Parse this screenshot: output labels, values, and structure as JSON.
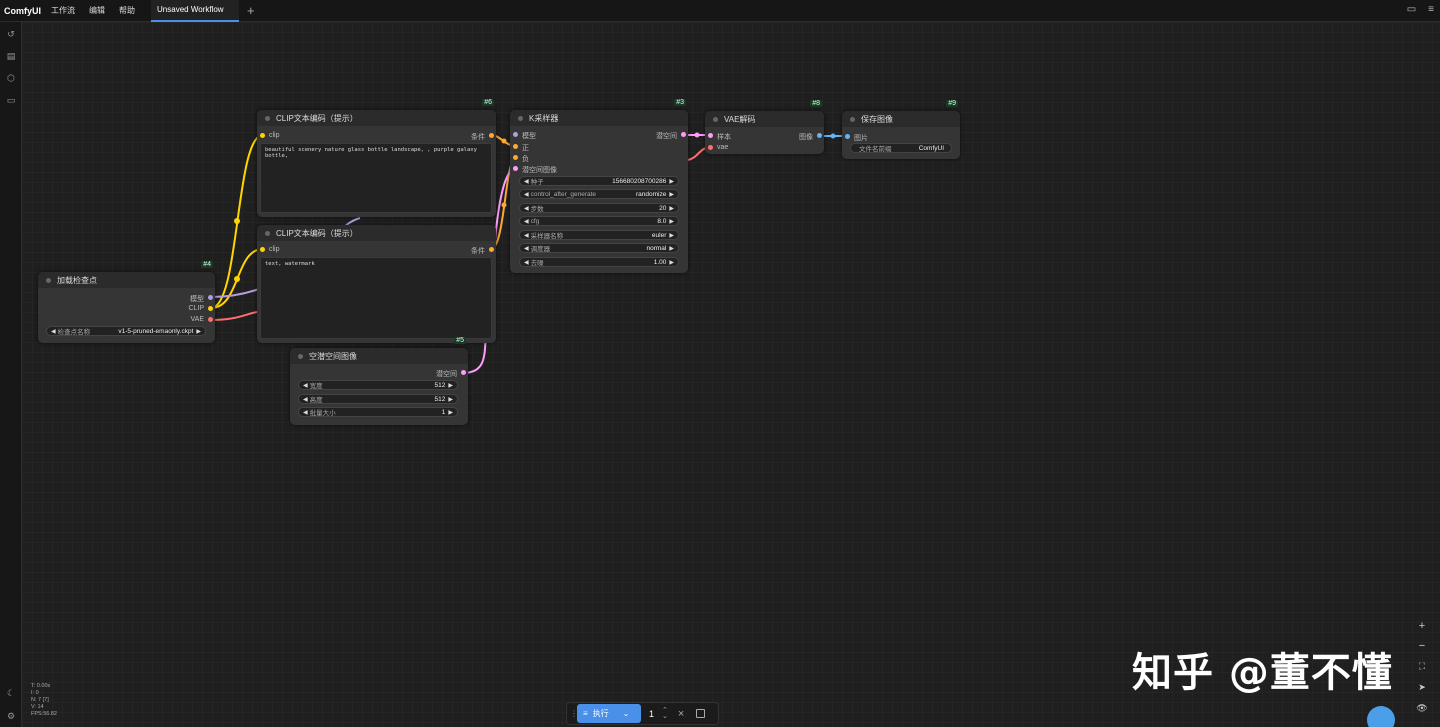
{
  "topbar": {
    "brand": "ComfyUI",
    "menus": [
      "工作流",
      "编辑",
      "帮助"
    ],
    "tab_label": "Unsaved Workflow",
    "add_tab": "+",
    "layout_icon": "▭",
    "menu_icon": "≡"
  },
  "sidebar_icons": [
    "history-icon",
    "document-icon",
    "cube-icon",
    "folder-icon",
    "moon-icon",
    "gear-icon"
  ],
  "nodes": {
    "checkpoint": {
      "id": "#4",
      "title": "加载检查点",
      "outputs": [
        "模型",
        "CLIP",
        "VAE"
      ],
      "widget_label": "检查点名称",
      "widget_value": "v1-5-pruned-emaonly.ckpt"
    },
    "clip_pos": {
      "id": "#6",
      "title": "CLIP文本编码（提示）",
      "input": "clip",
      "output": "条件",
      "text": "beautiful scenery nature glass bottle landscape, , purple galaxy bottle,"
    },
    "clip_neg": {
      "id": "#7",
      "title": "CLIP文本编码（提示）",
      "input": "clip",
      "output": "条件",
      "text": "text, watermark"
    },
    "latent": {
      "id": "#5",
      "title": "空潜空间图像",
      "output": "潜空间",
      "widgets": [
        {
          "label": "宽度",
          "value": "512"
        },
        {
          "label": "高度",
          "value": "512"
        },
        {
          "label": "批量大小",
          "value": "1"
        }
      ]
    },
    "ksampler": {
      "id": "#3",
      "title": "K采样器",
      "inputs": [
        "模型",
        "正",
        "负",
        "潜空间图像"
      ],
      "output": "潜空间",
      "widgets": [
        {
          "label": "种子",
          "value": "156680208700286"
        },
        {
          "label": "control_after_generate",
          "value": "randomize"
        },
        {
          "label": "步数",
          "value": "20"
        },
        {
          "label": "cfg",
          "value": "8.0"
        },
        {
          "label": "采样器名称",
          "value": "euler"
        },
        {
          "label": "调度器",
          "value": "normal"
        },
        {
          "label": "去噪",
          "value": "1.00"
        }
      ]
    },
    "vae_decode": {
      "id": "#8",
      "title": "VAE解码",
      "inputs": [
        "样本",
        "vae"
      ],
      "output": "图像"
    },
    "save": {
      "id": "#9",
      "title": "保存图像",
      "input": "图片",
      "widget_label": "文件名前缀",
      "widget_value": "ComfyUI"
    }
  },
  "runbar": {
    "run_label": "执行",
    "count": "1"
  },
  "stats": [
    "T: 0.00s",
    "I: 0",
    "N: 7 [7]",
    "V: 14",
    "FPS:56.82"
  ],
  "zoom_controls": [
    "+",
    "−",
    "⛶",
    "➤",
    "👁"
  ],
  "watermark": "知乎 @董不懂",
  "colors": {
    "model": "#b39ddb",
    "clip": "#ffd500",
    "vae": "#ff6e6e",
    "conditioning": "#ffa931",
    "latent": "#ff9cf9",
    "image": "#64b5f6",
    "accent": "#4a8fe8"
  }
}
